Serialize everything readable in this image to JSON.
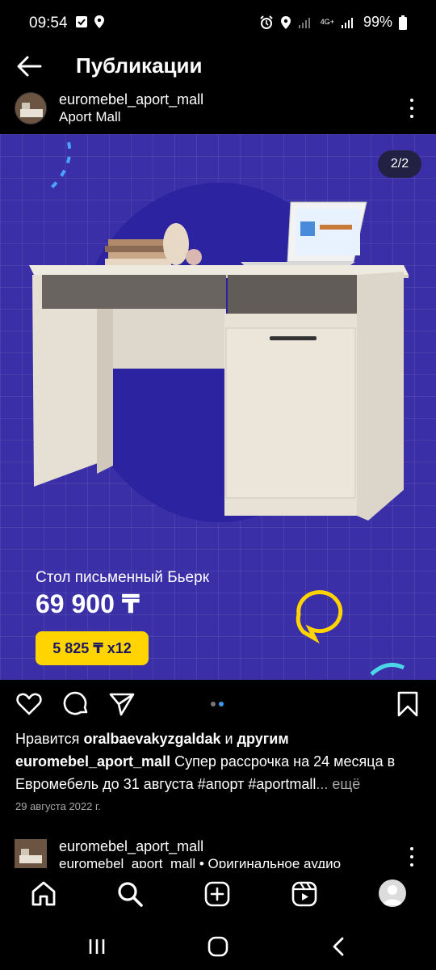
{
  "status_bar": {
    "time": "09:54",
    "battery": "99%",
    "network_label": "4G+"
  },
  "header": {
    "title": "Публикации"
  },
  "post": {
    "username": "euromebel_aport_mall",
    "location": "Aport Mall",
    "page_indicator": "2/2",
    "image_text": {
      "product_name": "Стол письменный Бьерк",
      "price": "69 900 ₸",
      "installment": "5 825 ₸ x12"
    },
    "likes_prefix": "Нравится ",
    "likes_user": "oralbaevakyzgaldak",
    "likes_and": " и ",
    "likes_others": "другим",
    "caption_user": "euromebel_aport_mall",
    "caption_text": " Супер рассрочка на 24 месяца в Евромебель до 31 августа #апорт #aportmall",
    "caption_more": "... ещё",
    "date": "29 августа 2022 г."
  },
  "next_post": {
    "username": "euromebel_aport_mall",
    "subtitle": "euromebel_aport_mall • Оригинальное аудио"
  },
  "colors": {
    "media_bg": "#3a2fa6",
    "badge_yellow": "#ffd400",
    "carousel_active": "#3897f0"
  },
  "icons": {
    "back": "arrow-left-icon",
    "more": "more-vertical-icon",
    "like": "heart-icon",
    "comment": "comment-icon",
    "share": "send-icon",
    "save": "bookmark-icon",
    "home": "home-icon",
    "search": "search-icon",
    "create": "plus-square-icon",
    "reels": "reels-icon",
    "profile": "avatar"
  }
}
